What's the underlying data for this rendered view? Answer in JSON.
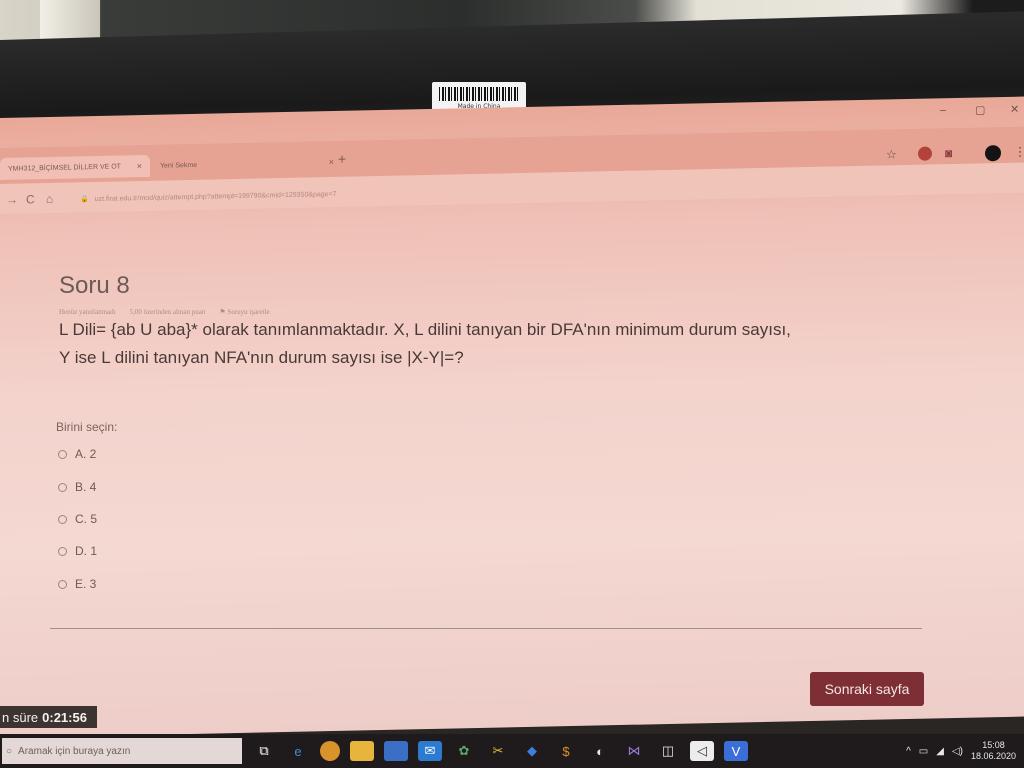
{
  "sticker": {
    "text": "Made in China"
  },
  "browser": {
    "tabs": [
      {
        "label": "YMH312_BİÇİMSEL DİLLER VE OT",
        "close": "×"
      },
      {
        "label": "Yeni Sekme",
        "close": "×"
      }
    ],
    "new_tab": "+",
    "window_controls": {
      "minimize": "–",
      "restore": "▢",
      "close": "✕"
    },
    "url": "uzt.firat.edu.tr/mod/quiz/attempt.php?attempt=199790&cmid=129350&page=7",
    "nav": {
      "back": "←",
      "forward": "→",
      "reload": "C",
      "home": "⌂"
    }
  },
  "question": {
    "title": "Soru 8",
    "status": "Henüz yanıtlanmadı",
    "points": "5,00 üzerinden alınan puan",
    "flag": "Soruyu işaretle",
    "text_line1": "L Dili= {ab U aba}* olarak tanımlanmaktadır. X, L dilini tanıyan bir DFA'nın minimum durum sayısı,",
    "text_line2": "Y ise L dilini tanıyan NFA'nın durum sayısı ise |X-Y|=?",
    "prompt": "Birini seçin:",
    "options": [
      "A. 2",
      "B. 4",
      "C. 5",
      "D. 1",
      "E. 3"
    ]
  },
  "footer": {
    "next_label": "Sonraki sayfa"
  },
  "timer": {
    "label": "n süre",
    "value": "0:21:56"
  },
  "taskbar": {
    "search_placeholder": "Aramak için buraya yazın",
    "time": "15:08",
    "date": "18.06.2020"
  },
  "colors": {
    "accent": "#7d2f35",
    "timer_bg": "#3d3331",
    "taskbar_bg": "#1f1b1c"
  }
}
